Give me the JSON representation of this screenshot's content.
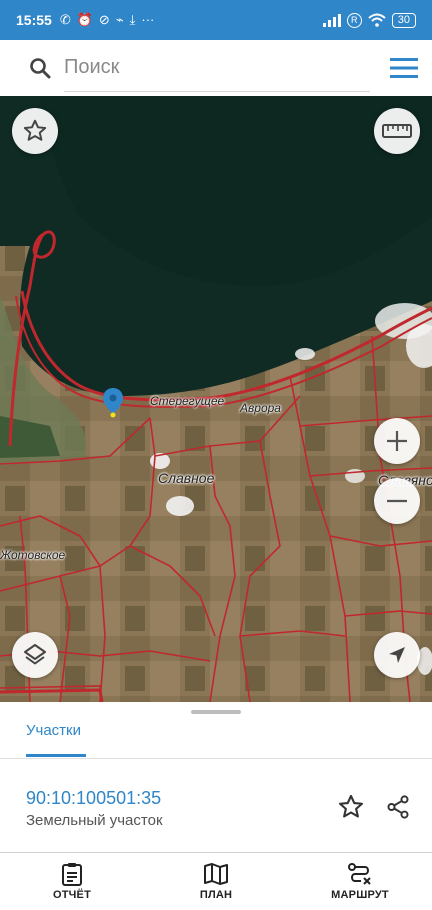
{
  "status_bar": {
    "time": "15:55",
    "battery": "30",
    "left_icons": [
      "call-icon",
      "alarm-icon",
      "vpn-icon",
      "usb-icon",
      "download-icon",
      "more-dots"
    ],
    "right_icons": [
      "signal-icon",
      "roaming-icon",
      "wifi-icon",
      "battery-icon"
    ]
  },
  "search": {
    "placeholder": "Поиск",
    "value": ""
  },
  "map": {
    "labels": {
      "steregushchee": "Стерегущее",
      "avrora": "Аврора",
      "slavnoe": "Славное",
      "slavyanskoe": "Славяно",
      "zhotovskoe": "Жотовское"
    },
    "buttons": [
      "favorite-star",
      "ruler",
      "zoom-in",
      "zoom-out",
      "layers",
      "my-location"
    ]
  },
  "sheet": {
    "tab_label": "Участки",
    "parcel": {
      "number": "90:10:100501:35",
      "type": "Земельный участок"
    }
  },
  "bottom_nav": {
    "items": [
      {
        "label": "ОТЧЁТ",
        "icon": "report-icon"
      },
      {
        "label": "ПЛАН",
        "icon": "map-plan-icon"
      },
      {
        "label": "МАРШРУТ",
        "icon": "route-icon"
      }
    ]
  },
  "colors": {
    "accent": "#2f86c8",
    "parcel_border": "#c0282d",
    "sea": "#0f2b24",
    "land": "#7a6a4e"
  }
}
